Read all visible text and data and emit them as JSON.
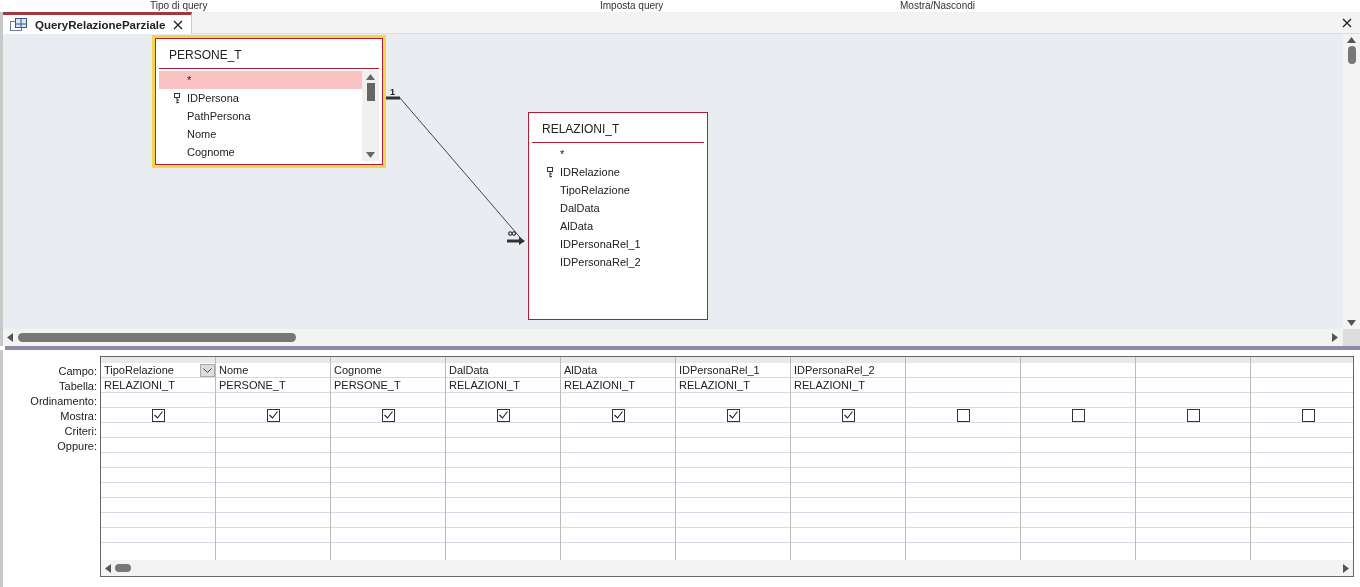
{
  "ribbon_groups": [
    "Tipo di query",
    "Imposta query",
    "Mostra/Nascondi"
  ],
  "tab": {
    "title": "QueryRelazioneParziale",
    "selected": true
  },
  "diagram": {
    "tables": [
      {
        "name": "PERSONE_T",
        "selected": true,
        "scrollable": true,
        "fields": [
          {
            "name": "*",
            "key": false,
            "highlighted": true
          },
          {
            "name": "IDPersona",
            "key": true,
            "highlighted": false
          },
          {
            "name": "PathPersona",
            "key": false,
            "highlighted": false
          },
          {
            "name": "Nome",
            "key": false,
            "highlighted": false
          },
          {
            "name": "Cognome",
            "key": false,
            "highlighted": false
          }
        ]
      },
      {
        "name": "RELAZIONI_T",
        "selected": false,
        "scrollable": false,
        "fields": [
          {
            "name": "*",
            "key": false,
            "highlighted": false
          },
          {
            "name": "IDRelazione",
            "key": true,
            "highlighted": false
          },
          {
            "name": "TipoRelazione",
            "key": false,
            "highlighted": false
          },
          {
            "name": "DalData",
            "key": false,
            "highlighted": false
          },
          {
            "name": "AlData",
            "key": false,
            "highlighted": false
          },
          {
            "name": "IDPersonaRel_1",
            "key": false,
            "highlighted": false
          },
          {
            "name": "IDPersonaRel_2",
            "key": false,
            "highlighted": false
          }
        ]
      }
    ],
    "relationship": {
      "one_label": "1",
      "many_label": "∞"
    }
  },
  "grid": {
    "row_labels": [
      "Campo:",
      "Tabella:",
      "Ordinamento:",
      "Mostra:",
      "Criteri:",
      "Oppure:"
    ],
    "columns": [
      {
        "field": "TipoRelazione",
        "table": "RELAZIONI_T",
        "show": true,
        "active": true
      },
      {
        "field": "Nome",
        "table": "PERSONE_T",
        "show": true,
        "active": false
      },
      {
        "field": "Cognome",
        "table": "PERSONE_T",
        "show": true,
        "active": false
      },
      {
        "field": "DalData",
        "table": "RELAZIONI_T",
        "show": true,
        "active": false
      },
      {
        "field": "AlData",
        "table": "RELAZIONI_T",
        "show": true,
        "active": false
      },
      {
        "field": "IDPersonaRel_1",
        "table": "RELAZIONI_T",
        "show": true,
        "active": false
      },
      {
        "field": "IDPersonaRel_2",
        "table": "RELAZIONI_T",
        "show": true,
        "active": false
      },
      {
        "show": false,
        "active": false
      },
      {
        "show": false,
        "active": false
      },
      {
        "show": false,
        "active": false
      },
      {
        "show": false,
        "active": false
      }
    ]
  }
}
